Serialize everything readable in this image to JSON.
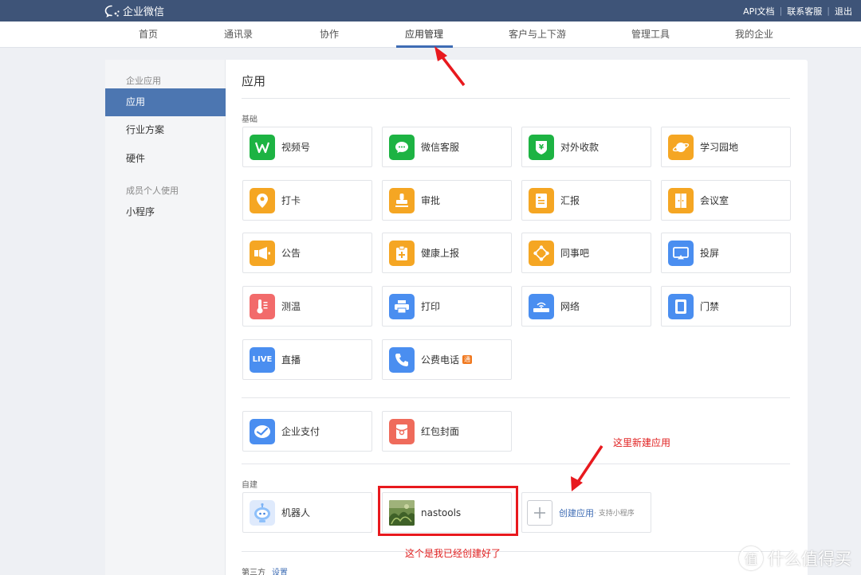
{
  "topbar": {
    "logo_text": "企业微信",
    "links": [
      "API文档",
      "联系客服",
      "退出"
    ]
  },
  "nav": {
    "items": [
      "首页",
      "通讯录",
      "协作",
      "应用管理",
      "客户与上下游",
      "管理工具",
      "我的企业"
    ],
    "active": "应用管理"
  },
  "sidebar": {
    "group1": "企业应用",
    "items1": [
      "应用",
      "行业方案",
      "硬件"
    ],
    "group2": "成员个人使用",
    "items2": [
      "小程序"
    ]
  },
  "main": {
    "title": "应用",
    "section_basic": "基础",
    "basic_apps": [
      {
        "label": "视频号",
        "icon": "channels-icon",
        "color": "#1db343"
      },
      {
        "label": "微信客服",
        "icon": "chat-bubble-icon",
        "color": "#1db343"
      },
      {
        "label": "对外收款",
        "icon": "yuan-shield-icon",
        "color": "#1db343"
      },
      {
        "label": "学习园地",
        "icon": "planet-icon",
        "color": "#f5a623"
      },
      {
        "label": "打卡",
        "icon": "location-pin-icon",
        "color": "#f5a623"
      },
      {
        "label": "审批",
        "icon": "stamp-icon",
        "color": "#f5a623"
      },
      {
        "label": "汇报",
        "icon": "report-icon",
        "color": "#f5a623"
      },
      {
        "label": "会议室",
        "icon": "door-icon",
        "color": "#f5a623"
      },
      {
        "label": "公告",
        "icon": "megaphone-icon",
        "color": "#f5a623"
      },
      {
        "label": "健康上报",
        "icon": "clipboard-plus-icon",
        "color": "#f5a623"
      },
      {
        "label": "同事吧",
        "icon": "diamond-nodes-icon",
        "color": "#f5a623"
      },
      {
        "label": "投屏",
        "icon": "screen-cast-icon",
        "color": "#4a8ef0"
      },
      {
        "label": "测温",
        "icon": "thermometer-icon",
        "color": "#f26b6b"
      },
      {
        "label": "打印",
        "icon": "printer-icon",
        "color": "#4a8ef0"
      },
      {
        "label": "网络",
        "icon": "wifi-router-icon",
        "color": "#4a8ef0"
      },
      {
        "label": "门禁",
        "icon": "access-card-icon",
        "color": "#4a8ef0"
      },
      {
        "label": "直播",
        "icon": "live-icon",
        "color": "#4a8ef0",
        "icon_text": "LIVE"
      },
      {
        "label": "公费电话",
        "icon": "phone-icon",
        "color": "#4a8ef0",
        "badge": "通"
      }
    ],
    "extra_apps": [
      {
        "label": "企业支付",
        "icon": "pay-check-icon",
        "color": "#4a8ef0"
      },
      {
        "label": "红包封面",
        "icon": "red-packet-icon",
        "color": "#ef6b5b"
      }
    ],
    "section_custom": "自建",
    "custom_apps": [
      {
        "label": "机器人",
        "icon": "robot-icon"
      },
      {
        "label": "nastools",
        "icon": "plant-photo-icon"
      }
    ],
    "create": {
      "label": "创建应用",
      "sub": "· 支持小程序"
    },
    "footer_label": "第三方",
    "footer_link": "设置"
  },
  "annotations": {
    "create_hint": "这里新建应用",
    "created_hint": "这个是我已经创建好了"
  },
  "watermark": {
    "text": "什么值得买",
    "symbol": "值"
  }
}
